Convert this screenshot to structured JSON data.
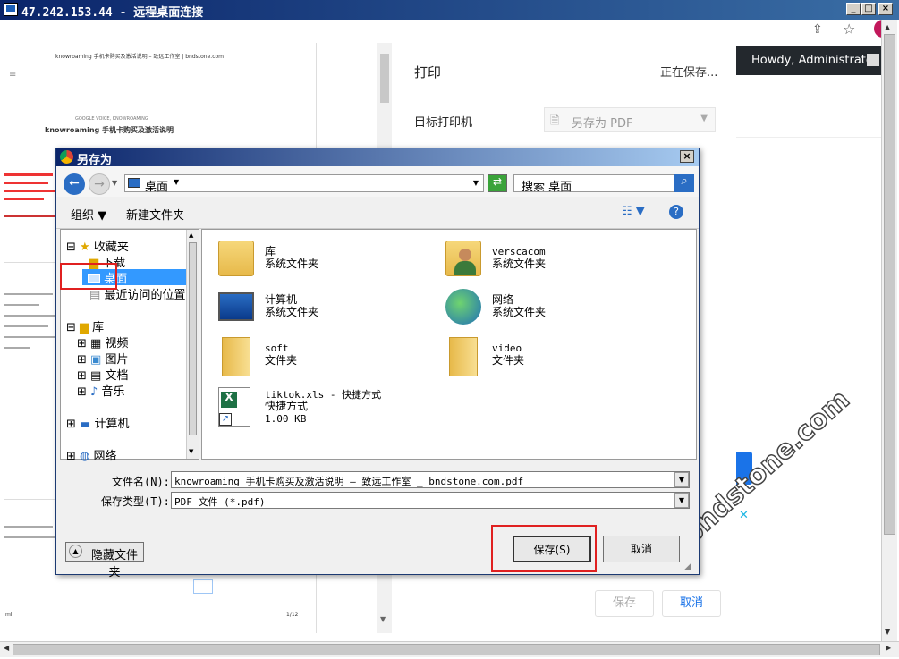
{
  "rdp": {
    "title": "47.242.153.44 - 远程桌面连接",
    "min": "_",
    "max": "□",
    "close": "×"
  },
  "browser": {
    "admin_greeting": "Howdy, Administrator",
    "pdf_header": "knowroaming 手机卡购买及激活说明 – 致远工作室 | bndstone.com",
    "pdf_heading_small": "GOOGLE VOICE, KNOWROAMING",
    "pdf_heading": "knowroaming 手机卡购买及激活说明",
    "pdf_footer_left": "ml",
    "pdf_footer_right": "1/12",
    "print_title": "打印",
    "print_status": "正在保存...",
    "printer_label": "目标打印机",
    "printer_value": "另存为 PDF",
    "save_button": "保存",
    "cancel_button": "取消",
    "watermark": "bndstone.com"
  },
  "dialog": {
    "title": "另存为",
    "address": "桌面",
    "search_placeholder": "搜索 桌面",
    "organize": "组织",
    "new_folder": "新建文件夹",
    "tree": {
      "favorites": "收藏夹",
      "downloads": "下载",
      "desktop": "桌面",
      "recent": "最近访问的位置",
      "libraries": "库",
      "videos": "视频",
      "pictures": "图片",
      "documents": "文档",
      "music": "音乐",
      "computer": "计算机",
      "network": "网络"
    },
    "files": [
      {
        "name": "库",
        "type": "系统文件夹"
      },
      {
        "name": "verscacom",
        "type": "系统文件夹"
      },
      {
        "name": "计算机",
        "type": "系统文件夹"
      },
      {
        "name": "网络",
        "type": "系统文件夹"
      },
      {
        "name": "soft",
        "type": "文件夹"
      },
      {
        "name": "video",
        "type": "文件夹"
      },
      {
        "name": "tiktok.xls - 快捷方式",
        "type": "快捷方式",
        "size": "1.00 KB"
      }
    ],
    "filename_label": "文件名(N):",
    "filename_value": "knowroaming 手机卡购买及激活说明 – 致远工作室 _ bndstone.com.pdf",
    "filetype_label": "保存类型(T):",
    "filetype_value": "PDF 文件 (*.pdf)",
    "hide_folders": "隐藏文件夹",
    "save": "保存(S)",
    "cancel": "取消"
  }
}
